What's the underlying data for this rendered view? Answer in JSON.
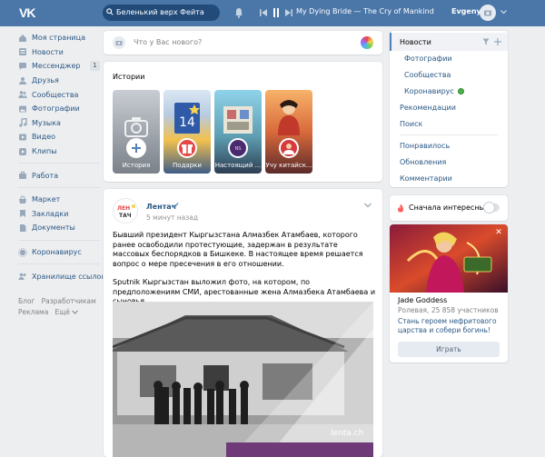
{
  "header": {
    "logo": "VK",
    "search_value": "Беленький верх Фейта",
    "track": "My Dying Bride — The Cry of Mankind",
    "user_name": "Evgeny"
  },
  "sidebar": {
    "items": [
      {
        "label": "Моя страница",
        "icon": "home-icon"
      },
      {
        "label": "Новости",
        "icon": "news-icon"
      },
      {
        "label": "Мессенджер",
        "icon": "messenger-icon",
        "badge": "1"
      },
      {
        "label": "Друзья",
        "icon": "friends-icon"
      },
      {
        "label": "Сообщества",
        "icon": "communities-icon"
      },
      {
        "label": "Фотографии",
        "icon": "photos-icon"
      },
      {
        "label": "Музыка",
        "icon": "music-icon"
      },
      {
        "label": "Видео",
        "icon": "video-icon"
      },
      {
        "label": "Клипы",
        "icon": "clips-icon"
      }
    ],
    "group2": [
      {
        "label": "Работа",
        "icon": "work-icon"
      }
    ],
    "group3": [
      {
        "label": "Маркет",
        "icon": "market-icon"
      },
      {
        "label": "Закладки",
        "icon": "bookmarks-icon"
      },
      {
        "label": "Документы",
        "icon": "documents-icon"
      }
    ],
    "group4": [
      {
        "label": "Коронавирус",
        "icon": "coronavirus-icon"
      }
    ],
    "group5": [
      {
        "label": "Хранилище ссылок",
        "icon": "links-storage-icon"
      }
    ],
    "footer": {
      "blog": "Блог",
      "developers": "Разработчикам",
      "ads": "Реклама",
      "more": "Ещё"
    }
  },
  "composer": {
    "placeholder": "Что у Вас нового?"
  },
  "stories": {
    "title": "Истории",
    "items": [
      {
        "label": "История"
      },
      {
        "label": "Подарки"
      },
      {
        "label": "Настоящий ..."
      },
      {
        "label": "Учу китайск..."
      }
    ]
  },
  "post": {
    "author": "Лентач",
    "time": "5 минут назад",
    "text1": "Бывший президент Кыргызстана Алмазбек Атамбаев, которого ранее освободили протестующие, задержан в результате массовых беспорядков в Бишкеке. В настоящее время решается вопрос о мере пресечения в его отношении.",
    "text2": "Sputnik Кыргызстан выложил фото, на котором, по предположениям СМИ, арестованные жена Алмазбека Атамбаева и сыновья",
    "watermark": "lenta.ch"
  },
  "right_nav": {
    "news": "Новости",
    "photos": "Фотографии",
    "communities": "Сообщества",
    "coronavirus": "Коронавирус",
    "recommendations": "Рекомендации",
    "search": "Поиск",
    "liked": "Понравилось",
    "updates": "Обновления",
    "comments": "Комментарии"
  },
  "interesting": {
    "label": "Сначала интересные"
  },
  "ad": {
    "game_name": "Jade Goddess",
    "sub": "Ролевая, 25 858 участников",
    "desc": "Стань героем нефритового царства и собери богинь!",
    "play": "Играть"
  },
  "colors": {
    "header": "#4a76a8",
    "accent": "#2a5885",
    "background": "#edeef0"
  }
}
